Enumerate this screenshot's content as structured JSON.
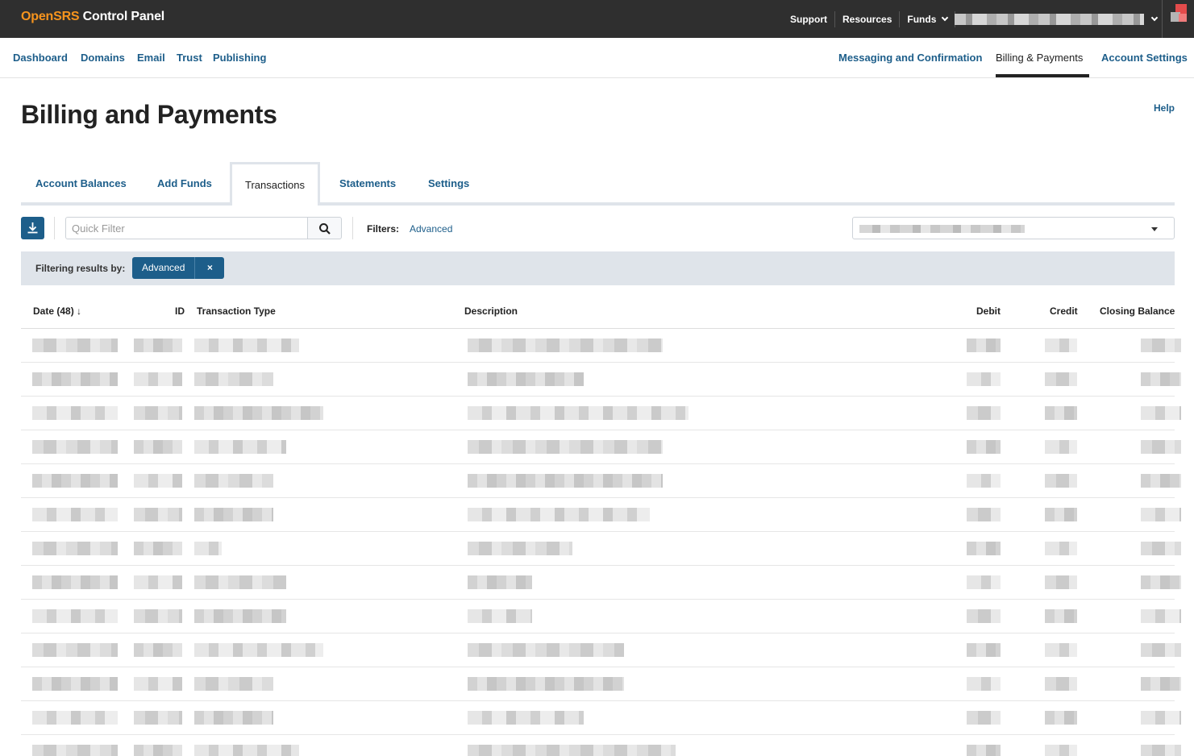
{
  "app": {
    "brand_prefix": "OpenSRS",
    "brand_suffix": "Control Panel"
  },
  "topnav": {
    "support": "Support",
    "resources": "Resources",
    "funds": "Funds"
  },
  "subnav": {
    "left": [
      "Dashboard",
      "Domains",
      "Email",
      "Trust",
      "Publishing"
    ],
    "messaging": "Messaging and Confirmation",
    "billing": "Billing & Payments",
    "account_settings": "Account Settings"
  },
  "page": {
    "title": "Billing and Payments",
    "help": "Help"
  },
  "tabs": [
    "Account Balances",
    "Add Funds",
    "Transactions",
    "Statements",
    "Settings"
  ],
  "toolbar": {
    "quick_filter_placeholder": "Quick Filter",
    "filters_label": "Filters:",
    "filters_link": "Advanced"
  },
  "filter_bar": {
    "label": "Filtering results by:",
    "chip": "Advanced",
    "chip_remove": "×"
  },
  "table": {
    "columns": {
      "date": "Date (48) ↓",
      "id": "ID",
      "type": "Transaction Type",
      "description": "Description",
      "debit": "Debit",
      "credit": "Credit",
      "closing": "Closing Balance"
    },
    "row_count": 13
  }
}
